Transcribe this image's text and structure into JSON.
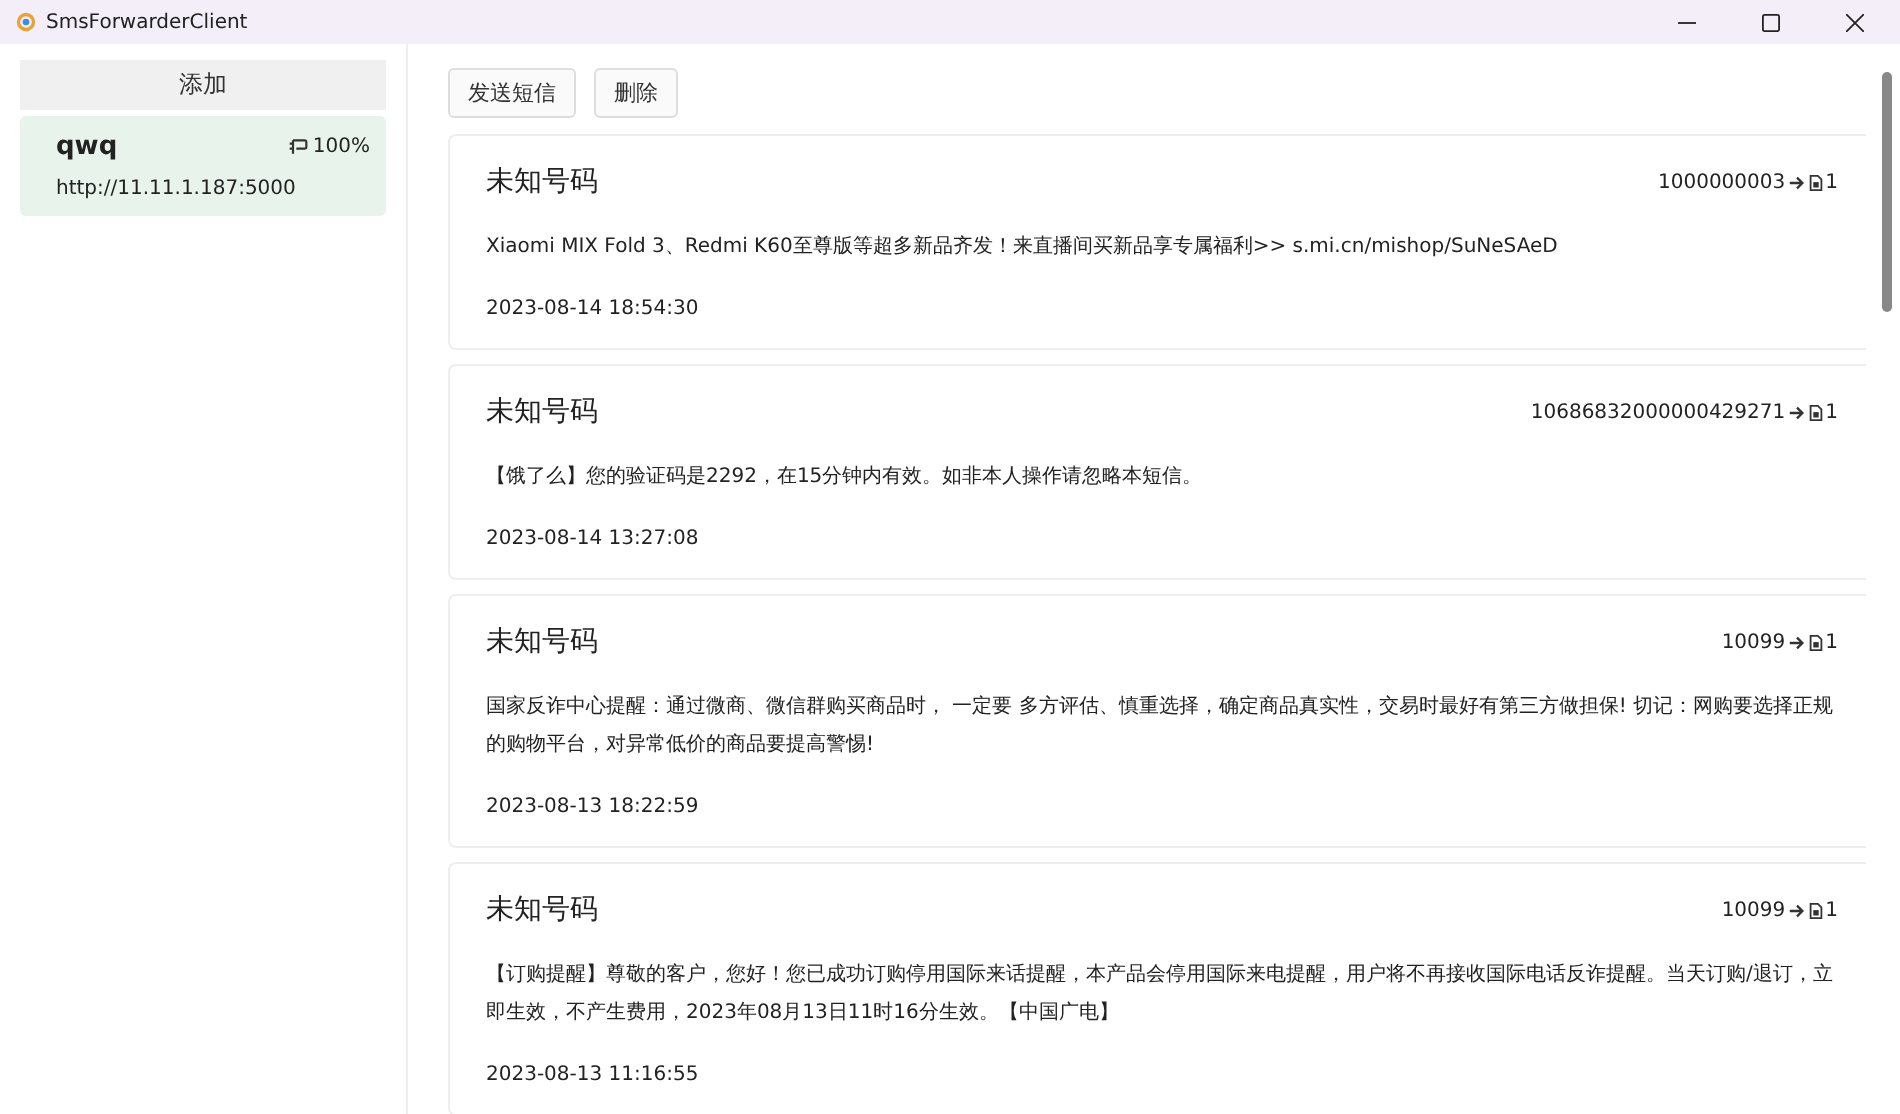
{
  "window": {
    "title": "SmsForwarderClient"
  },
  "sidebar": {
    "add_button": "添加",
    "items": [
      {
        "name": "qwq",
        "battery": "100%",
        "url": "http://11.11.1.187:5000",
        "selected": true
      }
    ]
  },
  "toolbar": {
    "buttons": [
      "发送短信",
      "删除"
    ]
  },
  "messages": [
    {
      "contact": "未知号码",
      "number": "1000000003",
      "sim": "1",
      "body": "Xiaomi MIX Fold 3、Redmi K60至尊版等超多新品齐发！来直播间买新品享专属福利>> s.mi.cn/mishop/SuNeSAeD",
      "time": "2023-08-14 18:54:30"
    },
    {
      "contact": "未知号码",
      "number": "10686832000000429271",
      "sim": "1",
      "body": "【饿了么】您的验证码是2292，在15分钟内有效。如非本人操作请忽略本短信。",
      "time": "2023-08-14 13:27:08"
    },
    {
      "contact": "未知号码",
      "number": "10099",
      "sim": "1",
      "body": "国家反诈中心提醒：通过微商、微信群购买商品时， 一定要 多方评估、慎重选择，确定商品真实性，交易时最好有第三方做担保! 切记：网购要选择正规的购物平台，对异常低价的商品要提高警惕!",
      "time": "2023-08-13 18:22:59"
    },
    {
      "contact": "未知号码",
      "number": "10099",
      "sim": "1",
      "body": "【订购提醒】尊敬的客户，您好！您已成功订购停用国际来话提醒，本产品会停用国际来电提醒，用户将不再接收国际电话反诈提醒。当天订购/退订，立即生效，不产生费用，2023年08月13日11时16分生效。【中国广电】",
      "time": "2023-08-13 11:16:55"
    }
  ]
}
